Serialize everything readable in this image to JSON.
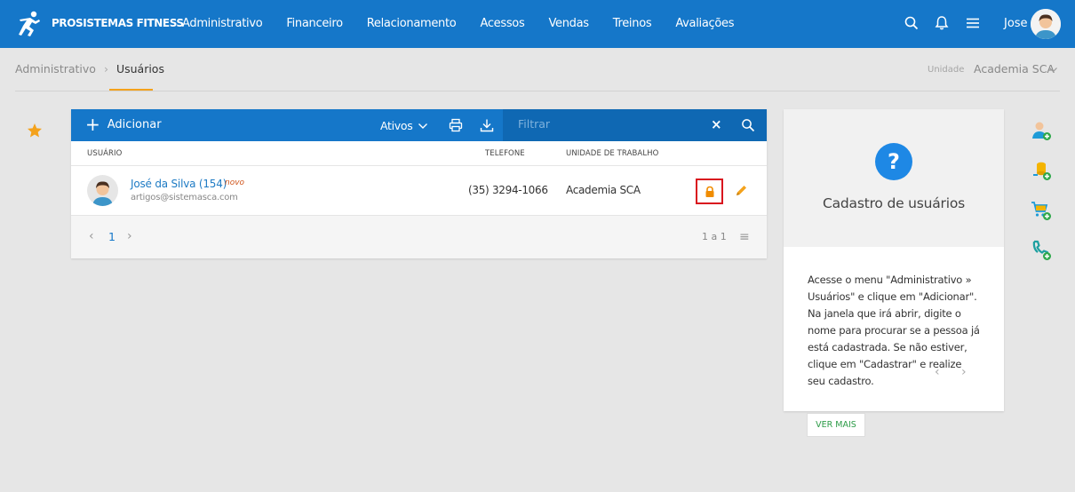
{
  "app": {
    "brand": "PROSISTEMAS FITNESS"
  },
  "nav": {
    "items": [
      "Administrativo",
      "Financeiro",
      "Relacionamento",
      "Acessos",
      "Vendas",
      "Treinos",
      "Avaliações"
    ]
  },
  "user": {
    "name": "Jose"
  },
  "breadcrumb": {
    "parent": "Administrativo",
    "separator": "›",
    "current": "Usuários"
  },
  "unit": {
    "label": "Unidade",
    "value": "Academia SCA"
  },
  "toolbar": {
    "add_label": "Adicionar",
    "status_filter": "Ativos",
    "search_placeholder": "Filtrar",
    "clear_label": "×"
  },
  "table": {
    "headers": {
      "user": "USUÁRIO",
      "phone": "TELEFONE",
      "unit": "UNIDADE DE TRABALHO"
    },
    "rows": [
      {
        "name": "José da Silva (154)",
        "badge": "novo",
        "email": "artigos@sistemasca.com",
        "phone": "(35) 3294-1066",
        "unit": "Academia SCA"
      }
    ]
  },
  "pager": {
    "prev": "‹",
    "page": "1",
    "next": "›",
    "count": "1 a 1",
    "menu": "≡"
  },
  "help": {
    "title": "Cadastro de usuários",
    "body": "Acesse o menu \"Administrativo » Usuários\" e clique em \"Adicionar\". Na janela que irá abrir, digite o nome para procurar se a pessoa já está cadastrada. Se não estiver, clique em \"Cadastrar\" e realize seu cadastro.",
    "prev": "‹",
    "next": "›",
    "more_label": "VER MAIS"
  },
  "colors": {
    "primary": "#1577c9",
    "accent_star": "#f4a21c",
    "lock": "#f08c00",
    "lock_border": "#d9141e",
    "side_icons": "#1e9bd7",
    "add_badge": "#2ea84a"
  },
  "icons": {
    "side_actions": [
      "add-user-icon",
      "add-coins-icon",
      "add-cart-icon",
      "add-call-icon"
    ]
  }
}
